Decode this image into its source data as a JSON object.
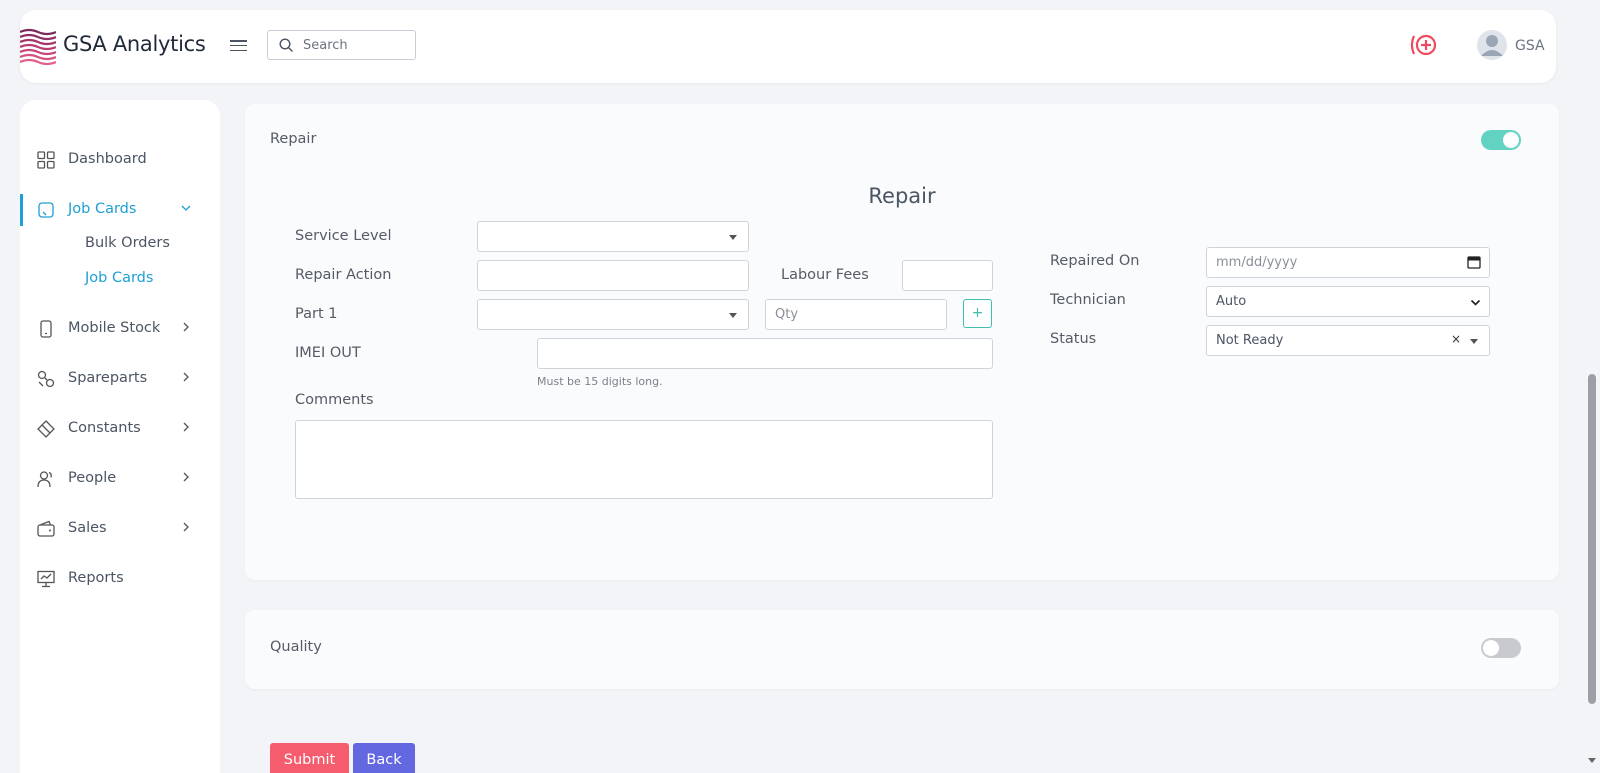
{
  "header": {
    "brand": "GSA Analytics",
    "search_placeholder": "Search",
    "user": "GSA"
  },
  "sidebar": {
    "items": [
      {
        "label": "Dashboard",
        "icon": "grid-icon"
      },
      {
        "label": "Job Cards",
        "icon": "card-icon",
        "active": true,
        "expanded": true,
        "children": [
          {
            "label": "Bulk Orders"
          },
          {
            "label": "Job Cards",
            "active": true
          }
        ]
      },
      {
        "label": "Mobile Stock",
        "icon": "mobile-icon"
      },
      {
        "label": "Spareparts",
        "icon": "spareparts-icon"
      },
      {
        "label": "Constants",
        "icon": "diamond-icon"
      },
      {
        "label": "People",
        "icon": "people-icon"
      },
      {
        "label": "Sales",
        "icon": "wallet-icon"
      },
      {
        "label": "Reports",
        "icon": "presentation-icon"
      }
    ]
  },
  "repair_panel": {
    "title": "Repair",
    "toggle_on": true,
    "heading": "Repair",
    "service_level_label": "Service Level",
    "service_level_value": "",
    "repair_action_label": "Repair Action",
    "repair_action_value": "",
    "labour_fees_label": "Labour Fees",
    "labour_fees_value": "",
    "part1_label": "Part 1",
    "part1_value": "",
    "qty_placeholder": "Qty",
    "add_part_label": "+",
    "imei_out_label": "IMEI OUT",
    "imei_out_value": "",
    "imei_hint": "Must be 15 digits long.",
    "comments_label": "Comments",
    "comments_value": "",
    "repaired_on_label": "Repaired On",
    "repaired_on_placeholder": "mm/dd/yyyy",
    "technician_label": "Technician",
    "technician_value": "Auto",
    "status_label": "Status",
    "status_value": "Not Ready",
    "status_clear": "×"
  },
  "quality_panel": {
    "title": "Quality",
    "toggle_on": false
  },
  "actions": {
    "submit": "Submit",
    "back": "Back"
  },
  "colors": {
    "accent": "#1e9fd4",
    "toggle_on": "#62d3c2",
    "submit": "#f55c6e",
    "back": "#6367e0",
    "alert": "#ef4a5e"
  }
}
